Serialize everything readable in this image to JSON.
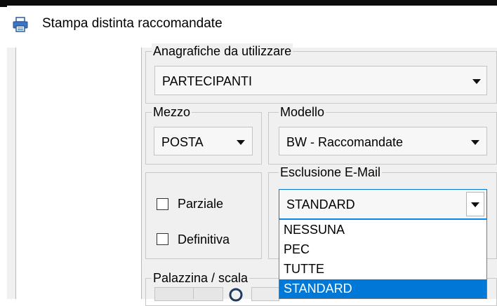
{
  "window": {
    "title": "Stampa distinta raccomandate",
    "icon": "printer-icon"
  },
  "anagrafiche": {
    "legend": "Anagrafiche da utilizzare",
    "value": "PARTECIPANTI"
  },
  "mezzo": {
    "legend": "Mezzo",
    "value": "POSTA"
  },
  "modello": {
    "legend": "Modello",
    "value": "BW - Raccomandate"
  },
  "options": {
    "parziale_label": "Parziale",
    "parziale_checked": false,
    "definitiva_label": "Definitiva",
    "definitiva_checked": false
  },
  "esclusione": {
    "legend": "Esclusione E-Mail",
    "value": "STANDARD",
    "open": true,
    "items": [
      "NESSUNA",
      "PEC",
      "TUTTE",
      "STANDARD"
    ],
    "selected_index": 3
  },
  "palazzina": {
    "legend": "Palazzina / scala",
    "icon": "search-icon"
  },
  "colors": {
    "selection": "#0078d7",
    "window_bg": "#f0f0f0",
    "combo_bg": "#f7f7f7"
  }
}
